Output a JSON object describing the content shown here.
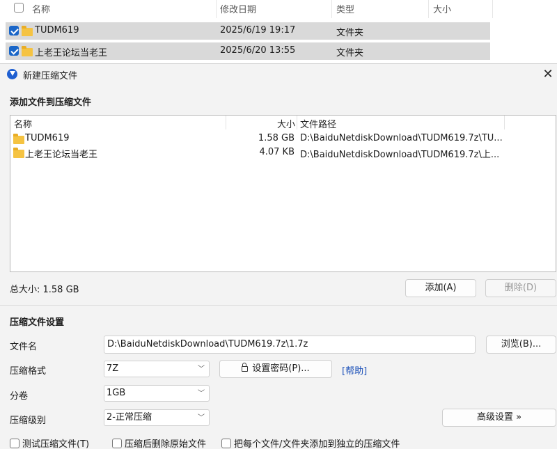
{
  "explorer": {
    "columns": [
      "名称",
      "修改日期",
      "类型",
      "大小"
    ],
    "rows": [
      {
        "name": "TUDM619",
        "date": "2025/6/19 19:17",
        "type": "文件夹"
      },
      {
        "name": "上老王论坛当老王",
        "date": "2025/6/20 13:55",
        "type": "文件夹"
      }
    ]
  },
  "dialog": {
    "title": "新建压缩文件",
    "close_glyph": "✕",
    "add_section_title": "添加文件到压缩文件",
    "list_columns": {
      "name": "名称",
      "size": "大小",
      "path": "文件路径"
    },
    "files": [
      {
        "name": "TUDM619",
        "size": "1.58 GB",
        "path": "D:\\BaiduNetdiskDownload\\TUDM619.7z\\TU..."
      },
      {
        "name": "上老王论坛当老王",
        "size": "4.07 KB",
        "path": "D:\\BaiduNetdiskDownload\\TUDM619.7z\\上..."
      }
    ],
    "total_size": "总大小: 1.58 GB",
    "add_button": "添加(A)",
    "delete_button": "删除(D)",
    "settings_title": "压缩文件设置",
    "filename_label": "文件名",
    "filename_value": "D:\\BaiduNetdiskDownload\\TUDM619.7z\\1.7z",
    "browse_button": "浏览(B)...",
    "format_label": "压缩格式",
    "format_value": "7Z",
    "password_button": "设置密码(P)...",
    "help_link": "[帮助]",
    "volume_label": "分卷",
    "volume_value": "1GB",
    "level_label": "压缩级别",
    "level_value": "2-正常压缩",
    "advanced_button": "高级设置 »",
    "options": [
      "测试压缩文件(T)",
      "压缩后删除原始文件",
      "把每个文件/文件夹添加到独立的压缩文件"
    ]
  },
  "colors": {
    "accent": "#1a66c8",
    "folder": "#f5c342",
    "link": "#1a4fb8"
  }
}
